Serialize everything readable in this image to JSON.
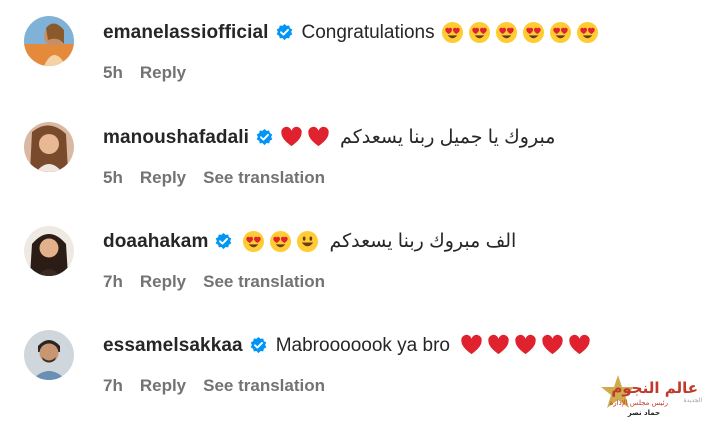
{
  "comments": [
    {
      "username": "emanelassiofficial",
      "text": "Congratulations",
      "emojis": [
        "heart-eyes",
        "heart-eyes",
        "heart-eyes",
        "heart-eyes",
        "heart-eyes",
        "heart-eyes"
      ],
      "time": "5h",
      "reply": "Reply",
      "see_translation": ""
    },
    {
      "username": "manoushafadali",
      "text": "مبروك يا جميل ربنا يسعدكم",
      "emojis": [
        "red-heart",
        "red-heart"
      ],
      "time": "5h",
      "reply": "Reply",
      "see_translation": "See translation"
    },
    {
      "username": "doaahakam",
      "text": "الف مبروك ربنا يسعدكم",
      "emojis": [
        "heart-eyes",
        "heart-eyes",
        "grinning-face"
      ],
      "time": "7h",
      "reply": "Reply",
      "see_translation": "See translation"
    },
    {
      "username": "essamelsakkaa",
      "text": "Mabrooooook ya bro",
      "emojis": [
        "red-heart",
        "red-heart",
        "red-heart",
        "red-heart",
        "red-heart"
      ],
      "time": "7h",
      "reply": "Reply",
      "see_translation": "See translation"
    }
  ],
  "watermark": {
    "name": "عالم النجوم",
    "subtitle": "رئيس مجلس الإدارة",
    "person": "حماد نصر",
    "tag": "الجديدة"
  },
  "colors": {
    "username": "#262626",
    "meta": "#737373",
    "verified": "#0095f6",
    "heart": "#e0212e",
    "emoji_face": "#ffcc33"
  }
}
